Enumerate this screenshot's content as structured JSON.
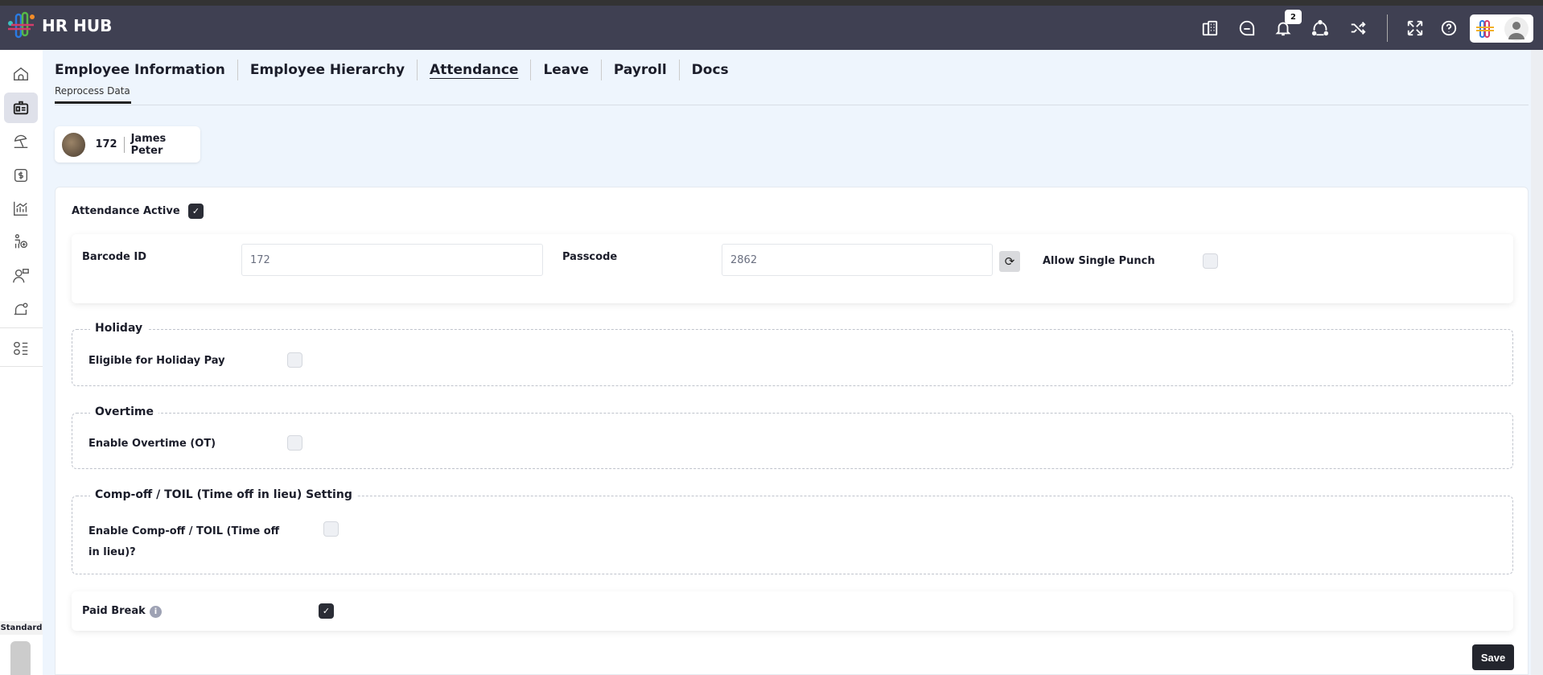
{
  "app": {
    "title": "HR HUB",
    "notification_count": "2"
  },
  "header_icons": [
    "directory-icon",
    "chat-icon",
    "bell-icon",
    "network-icon",
    "shuffle-icon",
    "fullscreen-icon",
    "help-icon"
  ],
  "sidebar": {
    "items": [
      "home",
      "employee",
      "holiday",
      "payroll",
      "reports",
      "onboarding",
      "feedback",
      "alerts",
      "apps"
    ],
    "mode_label": "Standard"
  },
  "tabs": [
    {
      "label": "Employee Information"
    },
    {
      "label": "Employee Hierarchy"
    },
    {
      "label": "Attendance",
      "active": true
    },
    {
      "label": "Leave"
    },
    {
      "label": "Payroll"
    },
    {
      "label": "Docs"
    }
  ],
  "subtab": "Reprocess Data",
  "employee": {
    "id": "172",
    "name": "James Peter"
  },
  "form": {
    "attendance_active": {
      "label": "Attendance Active",
      "checked": true
    },
    "barcode": {
      "label": "Barcode ID",
      "value": "172"
    },
    "passcode": {
      "label": "Passcode",
      "value": "2862"
    },
    "single_punch": {
      "label": "Allow Single Punch",
      "checked": false
    },
    "holiday": {
      "legend": "Holiday",
      "label": "Eligible for Holiday Pay",
      "checked": false
    },
    "overtime": {
      "legend": "Overtime",
      "label": "Enable Overtime (OT)",
      "checked": false
    },
    "compoff": {
      "legend": "Comp-off / TOIL (Time off in lieu) Setting",
      "label": "Enable Comp-off / TOIL (Time off in lieu)?",
      "checked": false
    },
    "paid_break": {
      "label": "Paid Break",
      "checked": true
    },
    "save_label": "Save"
  },
  "colors": {
    "header": "#3f4052",
    "accent": "#2b2d36",
    "background": "#eef5fd"
  }
}
